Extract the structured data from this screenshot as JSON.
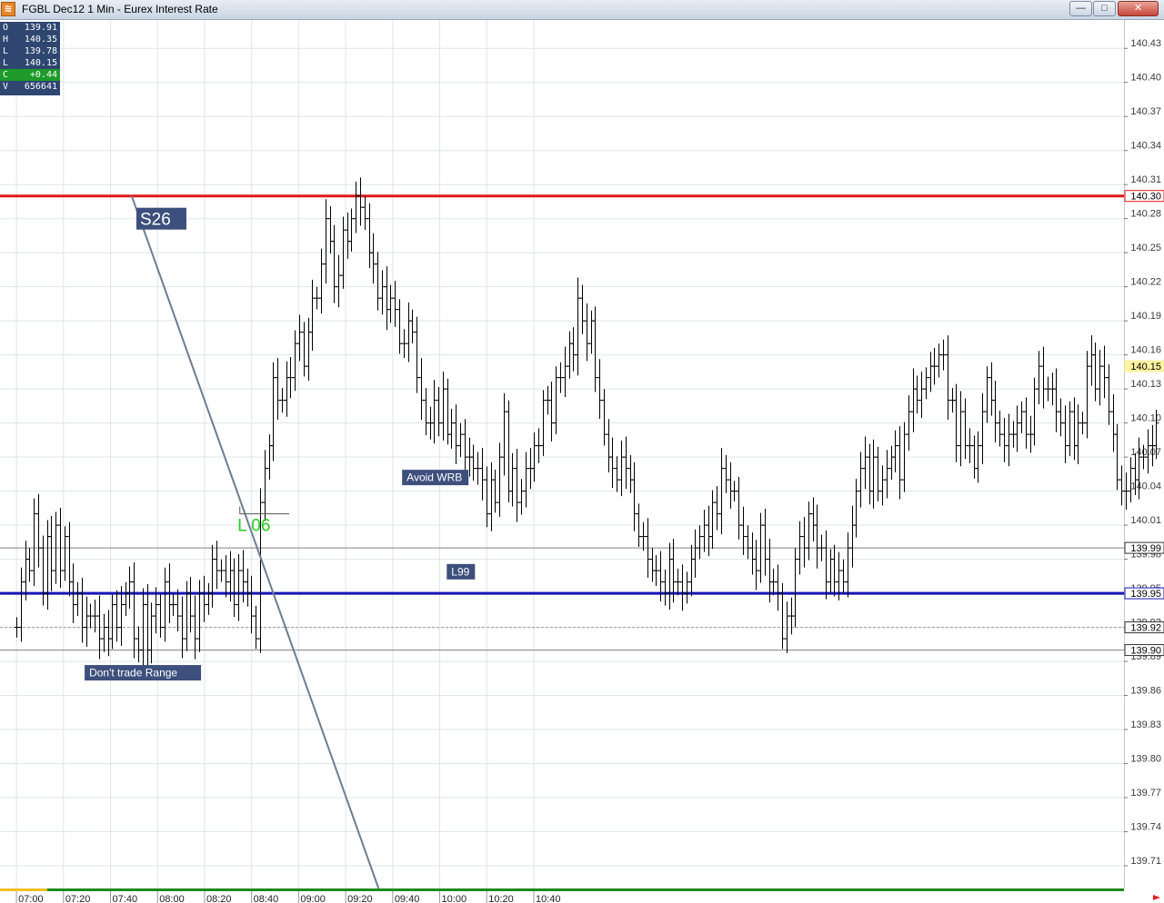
{
  "window": {
    "title": "FGBL Dec12 1 Min - Eurex Interest Rate",
    "icon": "app-chart-icon",
    "buttons": {
      "minimize": "—",
      "maximize": "□",
      "close": "✕"
    }
  },
  "ohlc": {
    "rows": [
      {
        "k": "O",
        "v": "139.91"
      },
      {
        "k": "H",
        "v": "140.35"
      },
      {
        "k": "L",
        "v": "139.78"
      },
      {
        "k": "L",
        "v": "140.15"
      },
      {
        "k": "C",
        "v": "+0.44"
      },
      {
        "k": "V",
        "v": "656641"
      }
    ]
  },
  "colors": {
    "resistance": "#e01818",
    "support": "#1515b8",
    "annotation_box": "#3d4f7c",
    "trend_line": "#6d7d90",
    "last_price_tag": "#fff2a0",
    "time_axis_bar": "#1e8a1e",
    "time_axis_marker": "#f0c020",
    "grid": "#dfe5ea",
    "bars": "#000000"
  },
  "chart_data": {
    "type": "ohlc",
    "y_range": [
      139.69,
      140.455
    ],
    "x_range": [
      413,
      891
    ],
    "price_ticks": [
      "140.43",
      "140.40",
      "140.37",
      "140.34",
      "140.31",
      "140.28",
      "140.25",
      "140.22",
      "140.19",
      "140.16",
      "140.13",
      "140.10",
      "140.07",
      "140.04",
      "140.01",
      "139.98",
      "139.95",
      "139.92",
      "139.89",
      "139.86",
      "139.83",
      "139.80",
      "139.77",
      "139.74",
      "139.71"
    ],
    "time_ticks": [
      {
        "t": 420,
        "label": "07:00"
      },
      {
        "t": 440,
        "label": "07:20"
      },
      {
        "t": 460,
        "label": "07:40"
      },
      {
        "t": 480,
        "label": "08:00"
      },
      {
        "t": 500,
        "label": "08:20"
      },
      {
        "t": 520,
        "label": "08:40"
      },
      {
        "t": 540,
        "label": "09:00"
      },
      {
        "t": 560,
        "label": "09:20"
      },
      {
        "t": 580,
        "label": "09:40"
      },
      {
        "t": 600,
        "label": "10:00"
      },
      {
        "t": 620,
        "label": "10:20"
      },
      {
        "t": 640,
        "label": "10:40"
      }
    ],
    "closes": [
      139.92,
      139.96,
      139.98,
      139.97,
      140.02,
      139.99,
      139.95,
      140.0,
      139.97,
      140.01,
      139.97,
      140.0,
      139.96,
      139.94,
      139.95,
      139.92,
      139.93,
      139.93,
      139.93,
      139.91,
      139.92,
      139.91,
      139.94,
      139.92,
      139.94,
      139.95,
      139.96,
      139.91,
      139.9,
      139.94,
      139.9,
      139.93,
      139.94,
      139.92,
      139.96,
      139.94,
      139.94,
      139.93,
      139.91,
      139.95,
      139.93,
      139.91,
      139.95,
      139.94,
      139.95,
      139.98,
      139.97,
      139.97,
      139.96,
      139.97,
      139.94,
      139.97,
      139.96,
      139.95,
      139.93,
      139.91,
      140.03,
      140.06,
      140.08,
      140.14,
      140.12,
      140.12,
      140.14,
      140.14,
      140.17,
      140.18,
      140.15,
      140.18,
      140.21,
      140.21,
      140.24,
      140.28,
      140.26,
      140.22,
      140.23,
      140.27,
      140.26,
      140.28,
      140.3,
      140.29,
      140.28,
      140.25,
      140.24,
      140.21,
      140.22,
      140.2,
      140.21,
      140.2,
      140.17,
      140.17,
      140.19,
      140.18,
      140.14,
      140.12,
      140.1,
      140.1,
      140.12,
      140.1,
      140.13,
      140.09,
      140.1,
      140.08,
      140.09,
      140.07,
      140.07,
      140.06,
      140.06,
      140.05,
      140.02,
      140.05,
      140.03,
      140.07,
      140.11,
      140.04,
      140.06,
      140.03,
      140.04,
      140.06,
      140.06,
      140.08,
      140.08,
      140.12,
      140.12,
      140.1,
      140.14,
      140.14,
      140.15,
      140.17,
      140.16,
      140.21,
      140.19,
      140.17,
      140.19,
      140.14,
      140.12,
      140.09,
      140.07,
      140.06,
      140.05,
      140.07,
      140.06,
      140.05,
      140.02,
      140.0,
      140.0,
      139.98,
      139.97,
      139.97,
      139.96,
      139.95,
      139.98,
      139.96,
      139.96,
      139.95,
      139.96,
      139.98,
      139.99,
      140.0,
      140.01,
      140.0,
      140.03,
      140.02,
      140.06,
      140.05,
      140.04,
      140.04,
      140.01,
      140.0,
      139.99,
      139.98,
      139.97,
      140.01,
      139.98,
      139.96,
      139.96,
      139.95,
      139.91,
      139.93,
      139.93,
      139.98,
      140.0,
      139.99,
      140.02,
      140.01,
      139.99,
      139.99,
      139.96,
      139.98,
      139.96,
      139.97,
      139.96,
      139.99,
      140.01,
      140.04,
      140.06,
      140.07,
      140.04,
      140.07,
      140.04,
      140.05,
      140.06,
      140.07,
      140.08,
      140.05,
      140.09,
      140.11,
      140.13,
      140.12,
      140.13,
      140.14,
      140.15,
      140.15,
      140.16,
      140.16,
      140.12,
      140.12,
      140.08,
      140.11,
      140.08,
      140.08,
      140.06,
      140.08,
      140.11,
      140.14,
      140.12,
      140.1,
      140.09,
      140.08,
      140.09,
      140.09,
      140.1,
      140.11,
      140.09,
      140.09,
      140.13,
      140.15,
      140.13,
      140.13,
      140.13,
      140.11,
      140.1,
      140.08,
      140.11,
      140.08,
      140.1,
      140.1,
      140.15,
      140.16,
      140.13,
      140.15,
      140.14,
      140.11,
      140.09,
      140.05,
      140.04,
      140.04,
      140.06,
      140.05,
      140.07,
      140.07,
      140.08,
      140.08,
      140.1
    ],
    "horizontal_lines": [
      {
        "name": "resistance-line",
        "price": 140.3,
        "color": "#e01818",
        "width": 3,
        "tag": "140.30"
      },
      {
        "name": "level-line-139-99",
        "price": 139.99,
        "color": "#808080",
        "width": 1,
        "tag": "139.99"
      },
      {
        "name": "support-line",
        "price": 139.95,
        "color": "#1515b8",
        "width": 3,
        "tag": "139.95"
      },
      {
        "name": "level-line-139-92",
        "price": 139.92,
        "color": "#9a9a9a",
        "width": 1,
        "dashed": true,
        "tag": "139.92"
      },
      {
        "name": "level-line-139-90",
        "price": 139.9,
        "color": "#808080",
        "width": 1,
        "tag": "139.90"
      }
    ],
    "last_price": {
      "price": 140.15,
      "tag": "140.15"
    },
    "trend_line": {
      "t1": 469,
      "p1": 140.3,
      "t2": 574,
      "p2": 139.69
    },
    "l06_bracket": {
      "t1": 515,
      "t2": 536,
      "price": 140.02
    },
    "annotations": [
      {
        "name": "annotation-s26",
        "text": "S26",
        "t": 471,
        "price": 140.28,
        "big": true
      },
      {
        "name": "annotation-dont-trade-range",
        "text": "Don't trade Range",
        "t": 449,
        "price": 139.88
      },
      {
        "name": "annotation-avoid-wrb",
        "text": "Avoid WRB",
        "t": 584,
        "price": 140.052
      },
      {
        "name": "annotation-l99",
        "text": "L99",
        "t": 603,
        "price": 139.969
      },
      {
        "name": "annotation-l06",
        "text": "L 06",
        "t": 514,
        "price": 140.005,
        "green": true
      }
    ]
  }
}
